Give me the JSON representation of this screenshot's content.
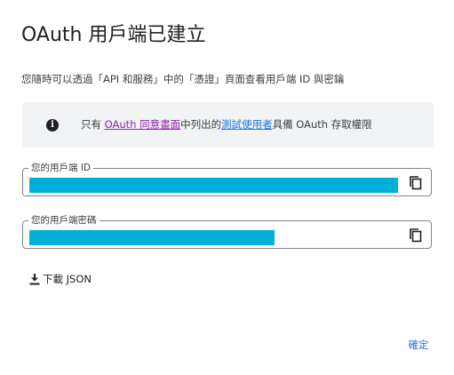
{
  "dialog": {
    "title": "OAuth 用戶端已建立",
    "subtitle": "您隨時可以透過「API 和服務」中的「憑證」頁面查看用戶端 ID 與密鑰"
  },
  "info": {
    "icon": "info-icon",
    "prefix": "只有",
    "consent_link": "OAuth 同意畫面",
    "middle": "中列出的",
    "testusers_link": "測試使用者",
    "suffix": "具備 OAuth 存取權限"
  },
  "client_id": {
    "label": "您的用戶端 ID",
    "value": "",
    "copy_icon": "copy-icon"
  },
  "client_secret": {
    "label": "您的用戶端密碼",
    "value": "",
    "copy_icon": "copy-icon"
  },
  "download": {
    "icon": "download-icon",
    "label": "下載 JSON"
  },
  "confirm": {
    "label": "確定"
  },
  "colors": {
    "accent": "#1a73e8",
    "consent_link": "#8e24aa",
    "redaction": "#00b0d8",
    "info_bg": "#f1f3f4"
  }
}
